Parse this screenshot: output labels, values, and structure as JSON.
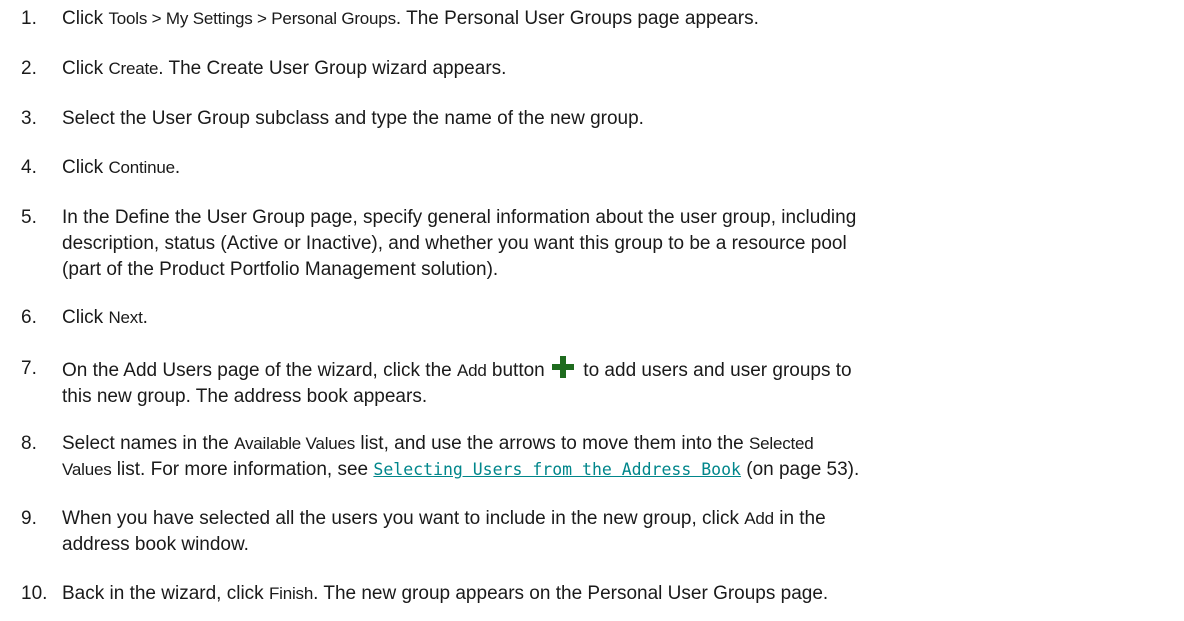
{
  "steps": [
    {
      "num": "1.",
      "a": "Click ",
      "b": "Tools > My Settings > Personal Groups",
      "c": ". The Personal User Groups page appears."
    },
    {
      "num": "2.",
      "a": "Click ",
      "b": "Create",
      "c": ". The Create User Group wizard appears."
    },
    {
      "num": "3.",
      "a": "Select the User Group subclass and type the name of the new group."
    },
    {
      "num": "4.",
      "a": "Click ",
      "b": "Continue",
      "c": "."
    },
    {
      "num": "5.",
      "l1": "In the Define the User Group page, specify general information about the user group, including",
      "l2": "description, status (Active or Inactive), and whether you want this group to be a resource pool",
      "l3": "(part of the Product Portfolio Management solution)."
    },
    {
      "num": "6.",
      "a": "Click ",
      "b": "Next",
      "c": "."
    },
    {
      "num": "7.",
      "a": "On the Add Users page of the wizard, click the ",
      "b": "Add",
      "c": " button",
      "icon": "plus-icon",
      "d": " to add users and user groups to",
      "l2": "this new group. The address book appears."
    },
    {
      "num": "8.",
      "a": "Select names in the ",
      "b": "Available Values",
      "c": " list, and use the arrows to move them into the ",
      "d": "Selected",
      "e": "Values",
      "f": " list. For more information, see ",
      "link": "Selecting Users from the Address Book",
      "g": " (on page 53)."
    },
    {
      "num": "9.",
      "a": "When you have selected all the users you want to include in the new group, click ",
      "b": "Add",
      "c": " in the",
      "l2": "address book window."
    },
    {
      "num": "10.",
      "a": "Back in the wizard, click ",
      "b": "Finish",
      "c": ". The new group appears on the Personal User Groups page."
    }
  ],
  "colors": {
    "link": "#00868b",
    "plus_icon": "#1e6b1e",
    "text": "#1a1a1a"
  }
}
